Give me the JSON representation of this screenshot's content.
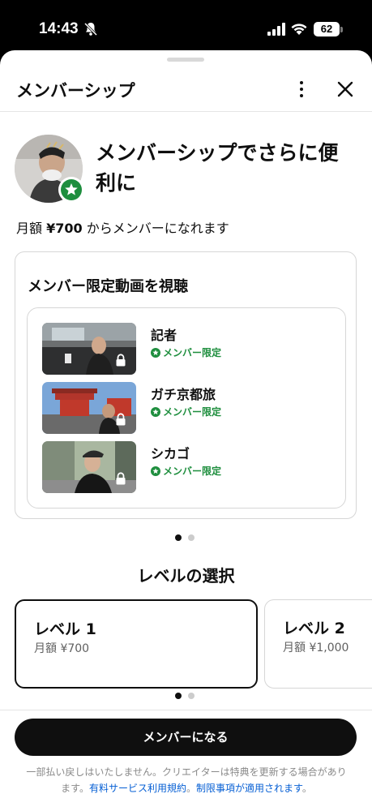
{
  "status_bar": {
    "time": "14:43",
    "battery": "62"
  },
  "header": {
    "title": "メンバーシップ"
  },
  "hero": {
    "title": "メンバーシップでさらに便利に",
    "price_prefix": "月額 ",
    "price": "¥700",
    "price_suffix": " からメンバーになれます"
  },
  "benefit": {
    "title": "メンバー限定動画を視聴",
    "videos": [
      {
        "title": "記者",
        "badge": "メンバー限定"
      },
      {
        "title": "ガチ京都旅",
        "badge": "メンバー限定"
      },
      {
        "title": "シカゴ",
        "badge": "メンバー限定"
      }
    ]
  },
  "carousel_page": 1,
  "levels": {
    "heading": "レベルの選択",
    "items": [
      {
        "name": "レベル 1",
        "price": "月額 ¥700",
        "selected": true
      },
      {
        "name": "レベル 2",
        "price": "月額 ¥1,000",
        "selected": false
      }
    ]
  },
  "cta": {
    "label": "メンバーになる"
  },
  "disclaimer": {
    "text": "一部払い戻しはいたしません。クリエイターは特典を更新する場合があります。",
    "link1": "有料サービス利用規約",
    "sep": "。",
    "link2": "制限事項が適用されます",
    "end": "。"
  },
  "colors": {
    "accent_green": "#1e8e3e",
    "primary": "#0f0f0f",
    "link": "#065fd4"
  },
  "icons": [
    "bell-slash-icon",
    "signal-icon",
    "wifi-icon",
    "battery-icon",
    "more-vert-icon",
    "close-icon",
    "member-star-icon",
    "lock-icon"
  ]
}
